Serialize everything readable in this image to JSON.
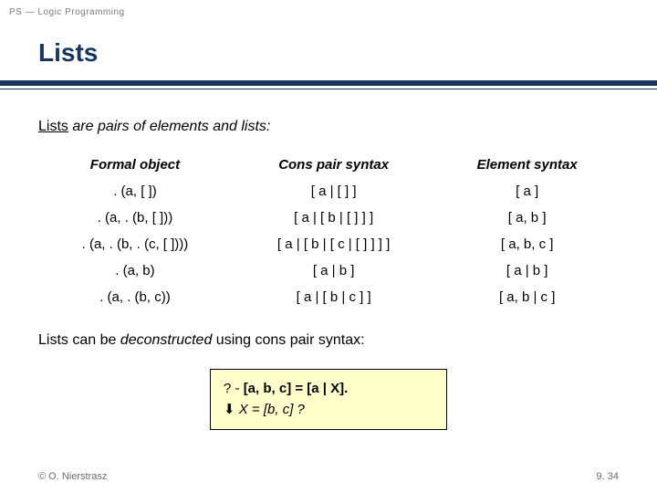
{
  "header": {
    "topLabel": "PS — Logic Programming",
    "title": "Lists"
  },
  "intro": {
    "subject": "Lists",
    "verb": " are ",
    "rest": "pairs of elements and lists:"
  },
  "table": {
    "headers": [
      "Formal object",
      "Cons pair syntax",
      "Element syntax"
    ],
    "rows": [
      [
        ". (a, [ ])",
        "[ a | [ ] ]",
        "[ a ]"
      ],
      [
        ". (a, . (b, [ ]))",
        "[ a | [ b | [ ] ] ]",
        "[ a, b ]"
      ],
      [
        ". (a, . (b, . (c, [ ])))",
        "[ a | [ b | [ c | [ ] ] ] ]",
        "[ a, b, c ]"
      ],
      [
        ". (a, b)",
        "[ a | b ]",
        "[ a | b ]"
      ],
      [
        ". (a, . (b, c))",
        "[ a | [ b | c ] ]",
        "[ a, b | c ]"
      ]
    ]
  },
  "post": {
    "pre": "Lists can be ",
    "emph": "deconstructed",
    "post": " using cons pair syntax:"
  },
  "code": {
    "prompt": "? - ",
    "query": "[a, b, c] = [a | X].",
    "arrow": "⬇",
    "result": " X = [b, c] ?"
  },
  "footer": {
    "left": "© O. Nierstrasz",
    "right": "9. 34"
  }
}
